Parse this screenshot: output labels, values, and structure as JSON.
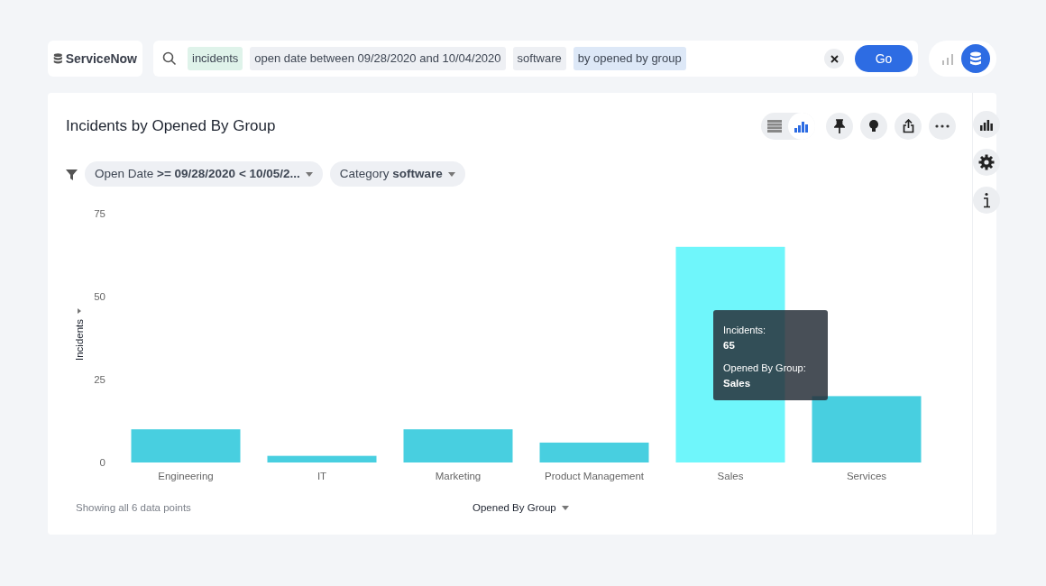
{
  "logo": {
    "text": "ServiceNow"
  },
  "search": {
    "tokens": [
      {
        "text": "incidents",
        "kind": "source"
      },
      {
        "text": "open date between 09/28/2020 and 10/04/2020",
        "kind": "filter"
      },
      {
        "text": "software",
        "kind": "filter"
      },
      {
        "text": "by opened by group",
        "kind": "grouping"
      }
    ],
    "go_button": "Go"
  },
  "card": {
    "title": "Incidents by Opened By Group",
    "view_toggle": [
      {
        "kind": "table",
        "selected": false
      },
      {
        "kind": "chart",
        "selected": true
      }
    ],
    "filters": [
      {
        "label": "Open Date",
        "value": ">= 09/28/2020 < 10/05/2..."
      },
      {
        "label": "Category",
        "value": "software"
      }
    ],
    "chart_data": {
      "type": "bar",
      "xlabel": "Opened By Group",
      "ylabel": "Incidents",
      "categories": [
        "Engineering",
        "IT",
        "Marketing",
        "Product Management",
        "Sales",
        "Services"
      ],
      "values": [
        10,
        2,
        10,
        6,
        65,
        20
      ],
      "ylim": [
        0,
        75
      ],
      "yticks": [
        0,
        25,
        50,
        75
      ]
    },
    "bar_states": [
      {
        "color": "#48cfe0"
      },
      {
        "color": "#48cfe0"
      },
      {
        "color": "#48cfe0"
      },
      {
        "color": "#48cfe0"
      },
      {
        "color": "#6ff6fb"
      },
      {
        "color": "#48cfe0"
      }
    ],
    "tooltip": {
      "rows": [
        {
          "label": "Incidents:",
          "value": "65"
        },
        {
          "label": "Opened By Group:",
          "value": "Sales"
        }
      ]
    },
    "footer": "Showing all 6 data points"
  }
}
